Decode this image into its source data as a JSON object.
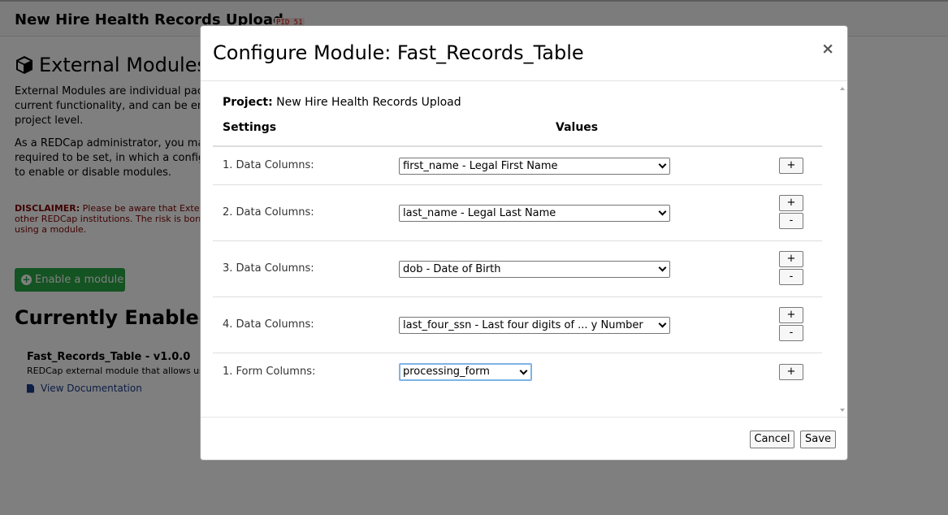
{
  "background": {
    "project_title": "New Hire Health Records Upload",
    "pid_badge": "PID 51",
    "external_modules_heading": "External Modules",
    "intro_paragraph": "External Modules are individual packages of software that can extend REDCap's current functionality, and can be enabled and configured at the system level or project level.",
    "admin_paragraph": "As a REDCap administrator, you may enable modules that might be required to be set, in which a configuration of any module at any time able to enable or disable modules.",
    "disclaimer_label": "DISCLAIMER:",
    "disclaimer_text": "Please be aware that External Modules are created by software developers at other REDCap institutions. The risk is borne by you and your local REDCap administrator when using a module.",
    "enable_module_button": "Enable a module",
    "currently_enabled_heading": "Currently Enabled Modules",
    "module_name": "Fast_Records_Table - v1.0.0",
    "module_description": "REDCap external module that allows users to",
    "view_documentation_link": "View Documentation"
  },
  "modal": {
    "title": "Configure Module: Fast_Records_Table",
    "close_symbol": "×",
    "project_label": "Project:",
    "project_name": "New Hire Health Records Upload",
    "settings_header": "Settings",
    "values_header": "Values",
    "rows": [
      {
        "label": "1. Data Columns:",
        "value": "first_name - Legal First Name",
        "buttons": [
          "+"
        ]
      },
      {
        "label": "2. Data Columns:",
        "value": "last_name - Legal Last Name",
        "buttons": [
          "+",
          "-"
        ]
      },
      {
        "label": "3. Data Columns:",
        "value": "dob - Date of Birth",
        "buttons": [
          "+",
          "-"
        ]
      },
      {
        "label": "4. Data Columns:",
        "value": "last_four_ssn - Last four digits of ... y Number",
        "buttons": [
          "+",
          "-"
        ]
      },
      {
        "label": "1. Form Columns:",
        "value": "processing_form",
        "buttons": [
          "+"
        ]
      }
    ],
    "cancel_button": "Cancel",
    "save_button": "Save"
  },
  "colors": {
    "enable_button_green": "#28a745",
    "focus_ring": "#7fb4e6",
    "pid_red": "#cc0000",
    "link_blue": "#1a3c8b"
  }
}
